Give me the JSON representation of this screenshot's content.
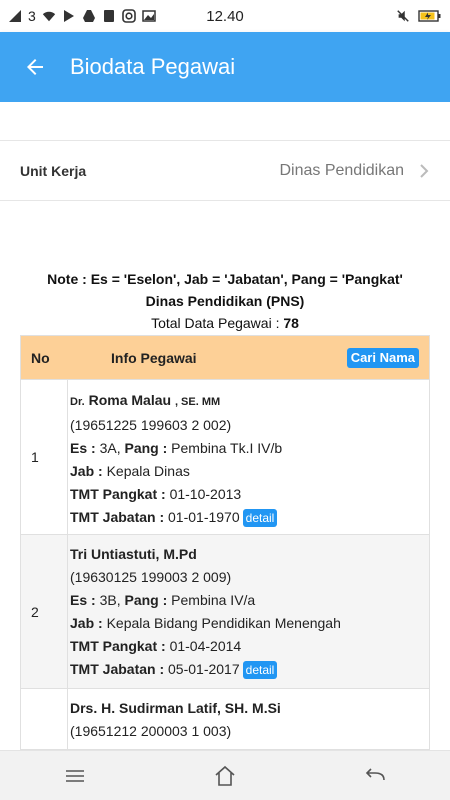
{
  "status_bar": {
    "signal_label": "3",
    "time": "12.40"
  },
  "app_bar": {
    "title": "Biodata Pegawai"
  },
  "unit_kerja": {
    "label": "Unit Kerja",
    "value": "Dinas Pendidikan"
  },
  "note": {
    "line1": "Note : Es = 'Eselon', Jab = 'Jabatan', Pang = 'Pangkat'",
    "line2": "Dinas Pendidikan (PNS)",
    "total_label": "Total Data Pegawai : ",
    "total_value": "78"
  },
  "table": {
    "col_no": "No",
    "col_info": "Info Pegawai",
    "search_button": "Cari Nama",
    "labels": {
      "es": "Es :",
      "pang": "Pang :",
      "jab": "Jab :",
      "tmt_pangkat": "TMT Pangkat :",
      "tmt_jabatan": "TMT Jabatan :",
      "detail": "detail"
    },
    "rows": [
      {
        "no": "1",
        "prefix": "Dr.",
        "name": "Roma Malau",
        "suffix": ", SE. MM",
        "nip": "(19651225 199603 2 002)",
        "es": "3A,",
        "pang": "Pembina Tk.I IV/b",
        "jab": "Kepala Dinas",
        "tmt_pangkat": "01-10-2013",
        "tmt_jabatan": "01-01-1970"
      },
      {
        "no": "2",
        "name": "Tri Untiastuti, M.Pd",
        "nip": "(19630125 199003 2 009)",
        "es": "3B,",
        "pang": "Pembina IV/a",
        "jab": "Kepala Bidang Pendidikan Menengah",
        "tmt_pangkat": "01-04-2014",
        "tmt_jabatan": "05-01-2017"
      },
      {
        "no": "",
        "name": "Drs. H. Sudirman Latif, SH. M.Si",
        "nip": "(19651212 200003 1 003)"
      }
    ]
  },
  "nav_bar": {
    "icons": [
      "menu-icon",
      "home-icon",
      "back-arrow-icon"
    ]
  },
  "colors": {
    "app_bar": "#3fa4f2",
    "table_header": "#fdd097",
    "button_blue": "#2196f3"
  }
}
